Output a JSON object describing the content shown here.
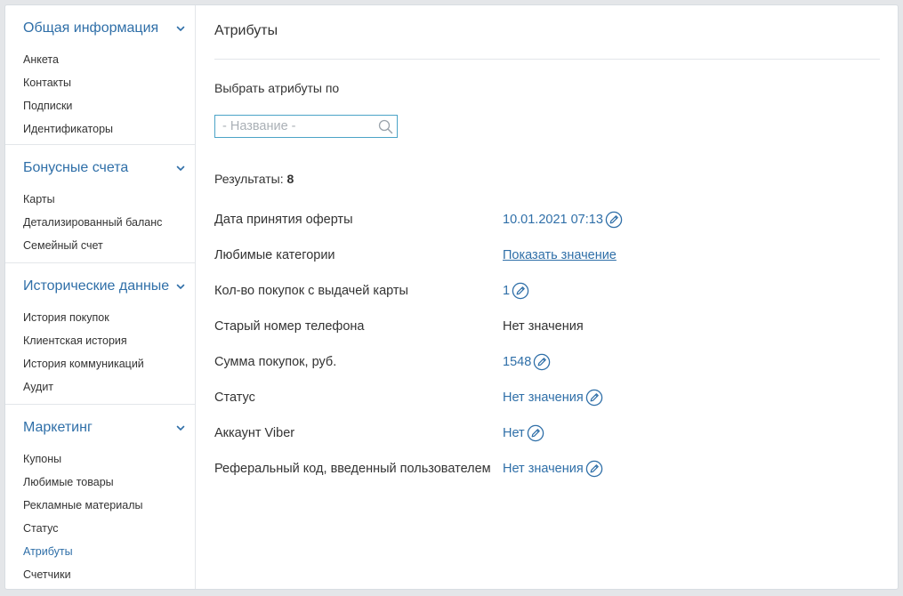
{
  "sidebar": {
    "sections": [
      {
        "title": "Общая информация",
        "items": [
          "Анкета",
          "Контакты",
          "Подписки",
          "Идентификаторы"
        ]
      },
      {
        "title": "Бонусные счета",
        "items": [
          "Карты",
          "Детализированный баланс",
          "Семейный счет"
        ]
      },
      {
        "title": "Исторические данные",
        "items": [
          "История покупок",
          "Клиентская история",
          "История коммуникаций",
          "Аудит"
        ]
      },
      {
        "title": "Маркетинг",
        "items": [
          "Купоны",
          "Любимые товары",
          "Рекламные материалы",
          "Статус",
          "Атрибуты",
          "Счетчики"
        ]
      }
    ],
    "active_item": "Атрибуты"
  },
  "main": {
    "title": "Атрибуты",
    "select_label": "Выбрать атрибуты по",
    "search": {
      "placeholder": "- Название -",
      "value": ""
    },
    "results_label": "Результаты:",
    "results_count": "8",
    "attributes": [
      {
        "name": "Дата принятия оферты",
        "value": "10.01.2021 07:13",
        "style": "link",
        "editable": true
      },
      {
        "name": "Любимые категории",
        "value": "Показать значение",
        "style": "underline",
        "editable": false
      },
      {
        "name": "Кол-во покупок с выдачей карты",
        "value": "1",
        "style": "link",
        "editable": true
      },
      {
        "name": "Старый номер телефона",
        "value": "Нет значения",
        "style": "plain",
        "editable": false
      },
      {
        "name": "Сумма покупок, руб.",
        "value": "1548",
        "style": "link",
        "editable": true
      },
      {
        "name": "Статус",
        "value": "Нет значения",
        "style": "link",
        "editable": true
      },
      {
        "name": "Аккаунт Viber",
        "value": "Нет",
        "style": "link",
        "editable": true
      },
      {
        "name": "Реферальный код, введенный пользователем",
        "value": "Нет значения",
        "style": "link",
        "editable": true
      }
    ]
  },
  "colors": {
    "accent": "#2f6fa8",
    "input_border": "#4ba3c7",
    "text": "#333333",
    "divider": "#e3e6ea"
  },
  "icons": {
    "section_toggle": "chevron-down-icon",
    "search": "search-icon",
    "edit": "pencil-circle-icon"
  }
}
